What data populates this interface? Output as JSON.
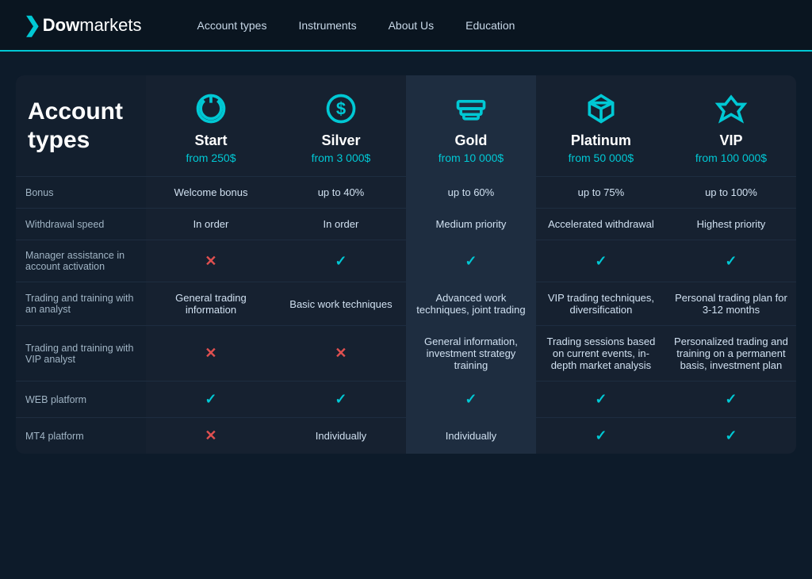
{
  "nav": {
    "logo_dow": "Dow",
    "logo_markets": "markets",
    "links": [
      {
        "label": "Account types",
        "id": "account-types"
      },
      {
        "label": "Instruments",
        "id": "instruments"
      },
      {
        "label": "About Us",
        "id": "about-us"
      },
      {
        "label": "Education",
        "id": "education"
      }
    ]
  },
  "page": {
    "title_line1": "Account",
    "title_line2": "types"
  },
  "plans": [
    {
      "id": "start",
      "name": "Start",
      "price": "from 250$",
      "icon": "power"
    },
    {
      "id": "silver",
      "name": "Silver",
      "price": "from 3 000$",
      "icon": "dollar"
    },
    {
      "id": "gold",
      "name": "Gold",
      "price": "from 10 000$",
      "icon": "bars"
    },
    {
      "id": "platinum",
      "name": "Platinum",
      "price": "from 50 000$",
      "icon": "diamond"
    },
    {
      "id": "vip",
      "name": "VIP",
      "price": "from 100 000$",
      "icon": "crown"
    }
  ],
  "rows": [
    {
      "label": "Bonus",
      "values": [
        "Welcome bonus",
        "up to 40%",
        "up to 60%",
        "up to 75%",
        "up to 100%"
      ]
    },
    {
      "label": "Withdrawal speed",
      "values": [
        "In order",
        "In order",
        "Medium priority",
        "Accelerated withdrawal",
        "Highest priority"
      ]
    },
    {
      "label": "Manager assistance in account activation",
      "values": [
        "cross",
        "check",
        "check",
        "check",
        "check"
      ]
    },
    {
      "label": "Trading and training with an analyst",
      "values": [
        "General trading information",
        "Basic work techniques",
        "Advanced work techniques, joint trading",
        "VIP trading techniques, diversification",
        "Personal trading plan for 3-12 months"
      ]
    },
    {
      "label": "Trading and training with VIP analyst",
      "values": [
        "cross",
        "cross",
        "General information, investment strategy training",
        "Trading sessions based on current events, in-depth market analysis",
        "Personalized trading and training on a permanent basis, investment plan"
      ]
    },
    {
      "label": "WEB platform",
      "values": [
        "check",
        "check",
        "check",
        "check",
        "check"
      ]
    },
    {
      "label": "MT4 platform",
      "values": [
        "cross",
        "Individually",
        "Individually",
        "check",
        "check"
      ]
    }
  ]
}
